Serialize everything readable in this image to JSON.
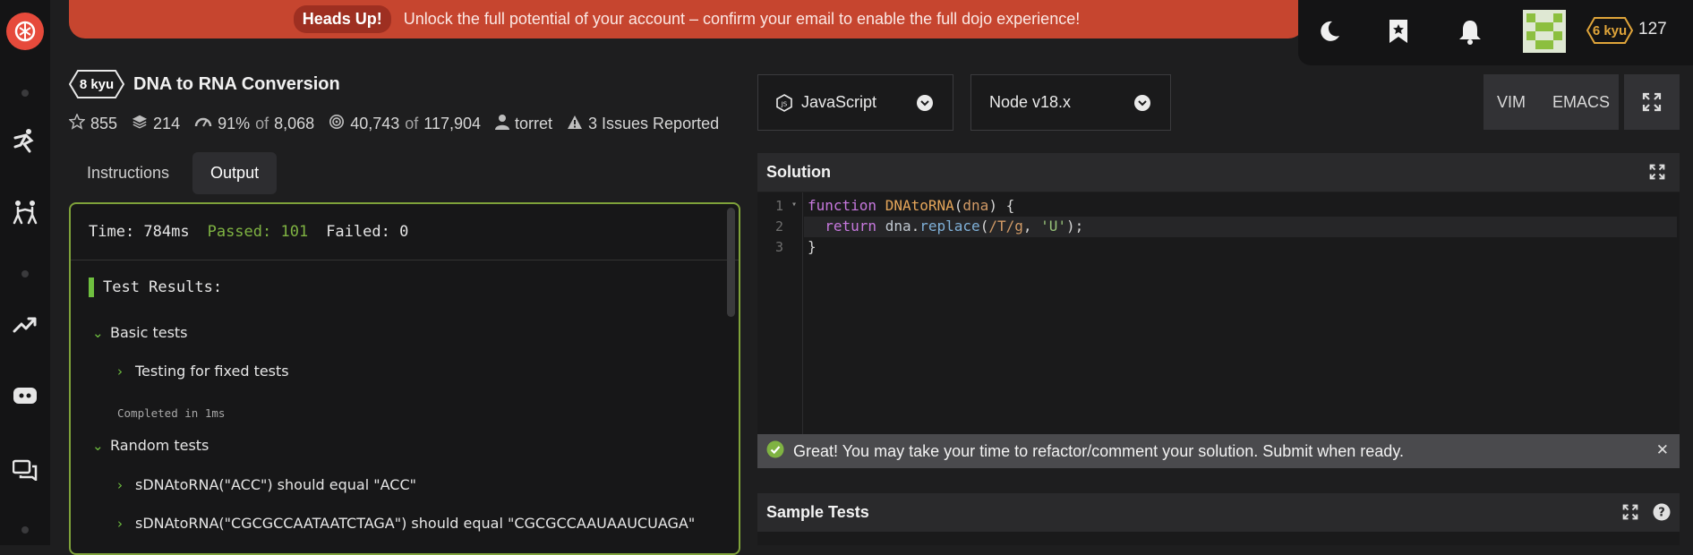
{
  "banner": {
    "badge": "Heads Up!",
    "message": "Unlock the full potential of your account – confirm your email to enable the full dojo experience!"
  },
  "topbar": {
    "user_rank": "6 kyu",
    "honor": "127",
    "icons": [
      "moon-icon",
      "bookmark-star-icon",
      "bell-icon",
      "avatar"
    ]
  },
  "kata": {
    "rank": "8 kyu",
    "title": "DNA to RNA Conversion",
    "stats": {
      "stars": "855",
      "collections": "214",
      "satisfaction_pct": "91%",
      "of_label": "of",
      "votes": "8,068",
      "completed": "40,743",
      "attempts": "117,904",
      "author": "torret",
      "issues": "3 Issues Reported"
    }
  },
  "tabs": [
    {
      "label": "Instructions",
      "active": false
    },
    {
      "label": "Output",
      "active": true
    }
  ],
  "output": {
    "time": "Time: 784ms",
    "passed": "Passed: 101",
    "failed": "Failed: 0",
    "results_title": "Test Results:",
    "groups": [
      {
        "label": "Basic tests"
      },
      {
        "label": "Testing for fixed tests"
      },
      {
        "label": "Completed in 1ms"
      },
      {
        "label": "Random tests"
      },
      {
        "label": "sDNAtoRNA(\"ACC\") should equal \"ACC\""
      },
      {
        "label": "sDNAtoRNA(\"CGCGCCAATAATCTAGA\") should equal \"CGCGCCAAUAAUCUAGA\""
      }
    ]
  },
  "language": {
    "selected": "JavaScript"
  },
  "version": {
    "selected": "Node v18.x"
  },
  "editor_modes": {
    "vim": "VIM",
    "emacs": "EMACS"
  },
  "solution": {
    "title": "Solution",
    "line_numbers": [
      "1",
      "2",
      "3"
    ]
  },
  "code_tokens": {
    "l1_kw": "function",
    "l1_fn": "DNAtoRNA",
    "l1_open": "(",
    "l1_param": "dna",
    "l1_close": ") {",
    "l2_kw": "return",
    "l2_obj": "dna",
    "l2_dot": ".",
    "l2_method": "replace",
    "l2_open": "(",
    "l2_rx": "/T/g",
    "l2_comma": ", ",
    "l2_str": "'U'",
    "l2_end": ");",
    "l3": "}"
  },
  "notice": {
    "message": "Great! You may take your time to refactor/comment your solution. Submit when ready."
  },
  "sample_tests": {
    "title": "Sample Tests"
  },
  "colors": {
    "accent_red": "#c6452f",
    "pass_green": "#7fb342",
    "rank_yellow": "#e0a53a",
    "border_green": "#7fa23a"
  }
}
